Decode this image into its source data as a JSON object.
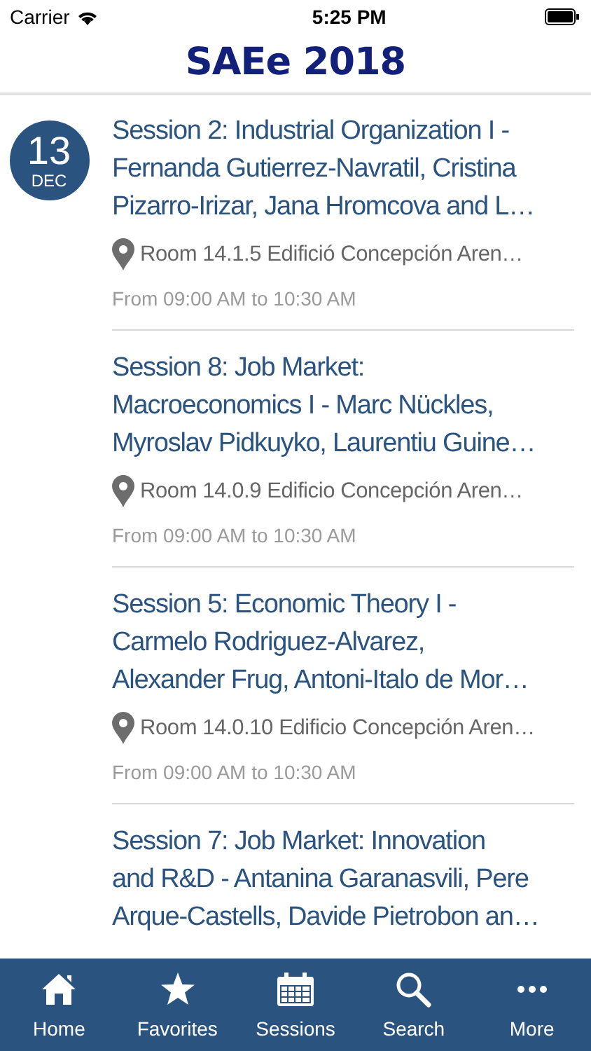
{
  "status_bar": {
    "carrier": "Carrier",
    "time": "5:25 PM"
  },
  "header": {
    "title": "SAEe 2018"
  },
  "date_badge": {
    "day": "13",
    "month": "DEC"
  },
  "sessions": [
    {
      "title_lines": [
        "Session 2: Industrial Organization I -",
        "Fernanda Gutierrez-Navratil, Cristina",
        "Pizarro-Irizar, Jana Hromcova and L…"
      ],
      "room": "Room 14.1.5 Edifició Concepción Aren…",
      "time": "From 09:00 AM to 10:30 AM"
    },
    {
      "title_lines": [
        "Session 8: Job Market:",
        "Macroeconomics I - Marc Nückles,",
        "Myroslav Pidkuyko, Laurentiu Guine…"
      ],
      "room": "Room 14.0.9 Edificio Concepción Aren…",
      "time": "From 09:00 AM to 10:30 AM"
    },
    {
      "title_lines": [
        "Session 5: Economic Theory I -",
        "Carmelo Rodriguez-Alvarez,",
        "Alexander Frug, Antoni-Italo de Mor…"
      ],
      "room": "Room 14.0.10 Edificio Concepción Aren…",
      "time": "From 09:00 AM to 10:30 AM"
    },
    {
      "title_lines": [
        "Session 7: Job Market: Innovation",
        "and R&D - Antanina Garanasvili, Pere",
        "Arque-Castells, Davide Pietrobon an…"
      ]
    }
  ],
  "tab_bar": [
    {
      "kind": "home",
      "label": "Home"
    },
    {
      "kind": "star",
      "label": "Favorites"
    },
    {
      "kind": "calendar",
      "label": "Sessions"
    },
    {
      "kind": "search",
      "label": "Search"
    },
    {
      "kind": "more",
      "label": "More"
    }
  ]
}
